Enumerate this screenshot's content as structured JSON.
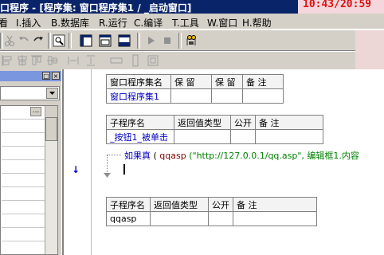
{
  "window": {
    "title": "口程序 - [程序集: 窗口程序集1 / _启动窗口]",
    "clock": "10:43/20:59"
  },
  "menu": {
    "items": [
      {
        "label": "看"
      },
      {
        "label": "I.插入"
      },
      {
        "label": "B.数据库"
      },
      {
        "label": "R.运行"
      },
      {
        "label": "C.编译"
      },
      {
        "label": "T.工具"
      },
      {
        "label": "W.窗口"
      },
      {
        "label": "H.帮助"
      }
    ]
  },
  "toolbar": {
    "icons": [
      "scissors-icon",
      "undo-icon",
      "redo-icon",
      "find-icon",
      "layout1-icon",
      "layout2-icon",
      "layout3-icon",
      "run-icon",
      "stop-icon",
      "debug-icon"
    ]
  },
  "left_panel": {
    "pin_label": "□",
    "close_label": "×",
    "more_label": "..."
  },
  "editor": {
    "assembly_table": {
      "headers": [
        "窗口程序集名",
        "保 留",
        "保 留",
        "备 注"
      ],
      "rows": [
        [
          "窗口程序集1",
          "",
          "",
          ""
        ]
      ]
    },
    "sub1_table": {
      "headers": [
        "子程序名",
        "返回值类型",
        "公开",
        "备 注"
      ],
      "rows": [
        [
          "_按钮1_被单击",
          "",
          "",
          ""
        ]
      ]
    },
    "code": {
      "keyword": "如果真",
      "open_paren": " (",
      "func": "qqasp",
      "args": " (\"http://127.0.0.1/qq.asp\", 编辑框1.内容"
    },
    "sub2_table": {
      "headers": [
        "子程序名",
        "返回值类型",
        "公开",
        "备 注"
      ],
      "rows": [
        [
          "qqasp",
          "",
          "",
          ""
        ]
      ]
    },
    "arrow_marker": "↓"
  },
  "colors": {
    "titlebar": "#0a246a",
    "clock": "#e01010",
    "keyword": "#0000c0",
    "string": "#008000",
    "func": "#800000"
  }
}
